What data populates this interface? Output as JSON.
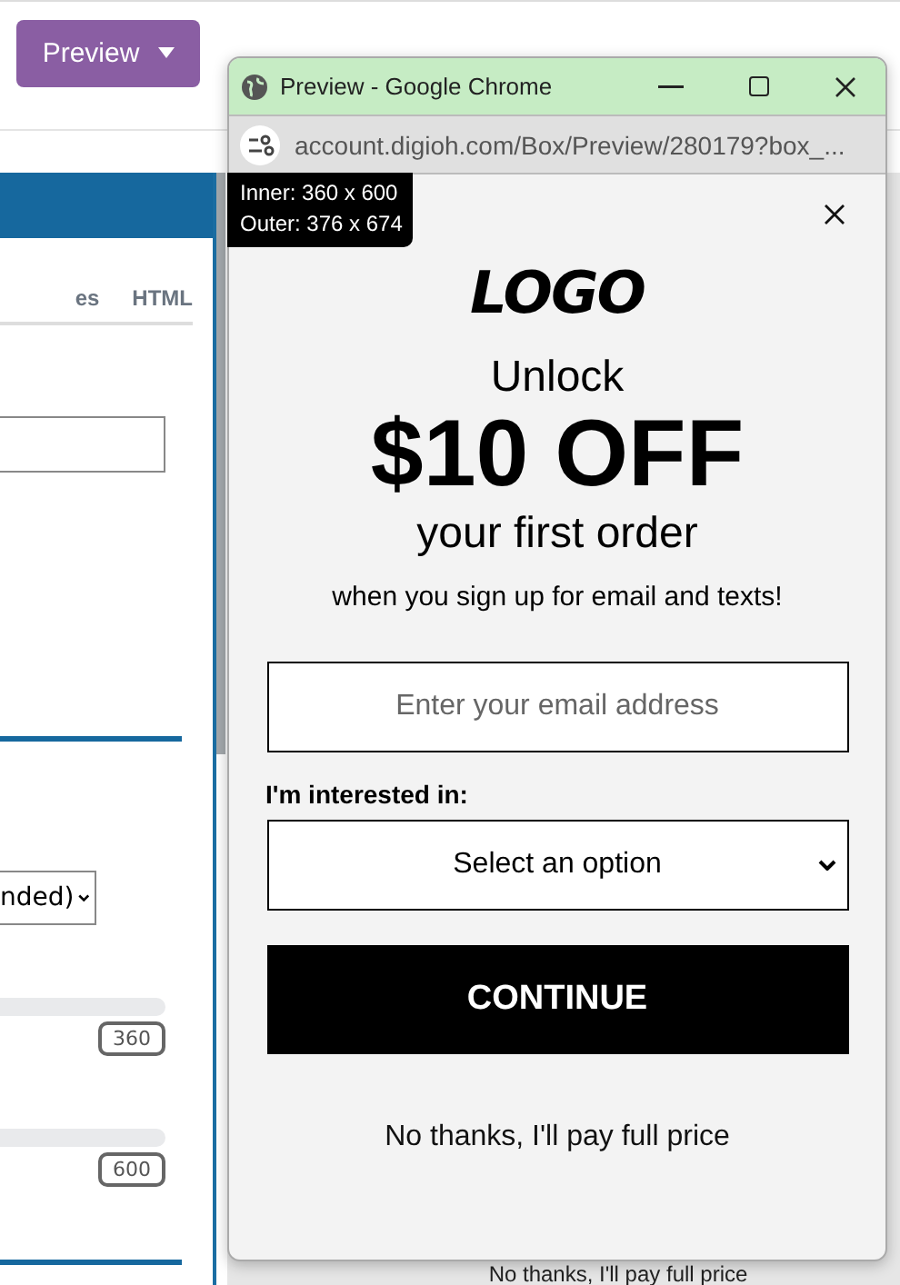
{
  "toolbar": {
    "preview_button": "Preview"
  },
  "editor": {
    "tabs": [
      {
        "label": "es",
        "selected": false
      },
      {
        "label": "HTML",
        "selected": false
      }
    ],
    "select_value": "nded)",
    "sliders": [
      {
        "value": "360"
      },
      {
        "value": "600"
      }
    ],
    "behind_text": "No thanks, I'll pay full price"
  },
  "popup_window": {
    "title": "Preview - Google Chrome",
    "url": "account.digioh.com/Box/Preview/280179?box_...",
    "size_tooltip": [
      "Inner: 360 x 600",
      "Outer: 376 x 674"
    ],
    "logo": "LOGO",
    "headline": "Unlock",
    "offer": "$10 OFF",
    "subhead": "your first order",
    "note": "when you sign up for email and texts!",
    "email_placeholder": "Enter your email address",
    "interest_label": "I'm interested in:",
    "interest_select": "Select an option",
    "continue_button": "CONTINUE",
    "decline_link": "No thanks, I'll pay full price"
  }
}
